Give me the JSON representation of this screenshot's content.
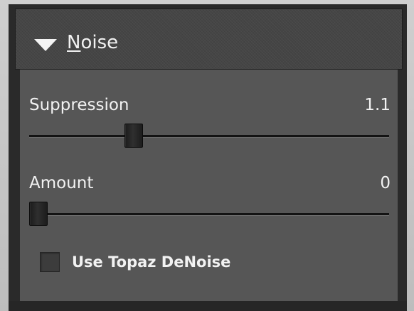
{
  "panel": {
    "title_first_letter": "N",
    "title_rest": "oise",
    "expanded": true
  },
  "suppression": {
    "label": "Suppression",
    "value": "1.1",
    "slider_fraction": 0.28
  },
  "amount": {
    "label": "Amount",
    "value": "0",
    "slider_fraction": 0.0
  },
  "denoise": {
    "label": "Use Topaz DeNoise",
    "checked": false
  },
  "icons": {
    "collapse": "triangle-down-icon"
  },
  "colors": {
    "panel_background": "#565656",
    "header_background": "#454545",
    "text": "#f2f2f2"
  }
}
